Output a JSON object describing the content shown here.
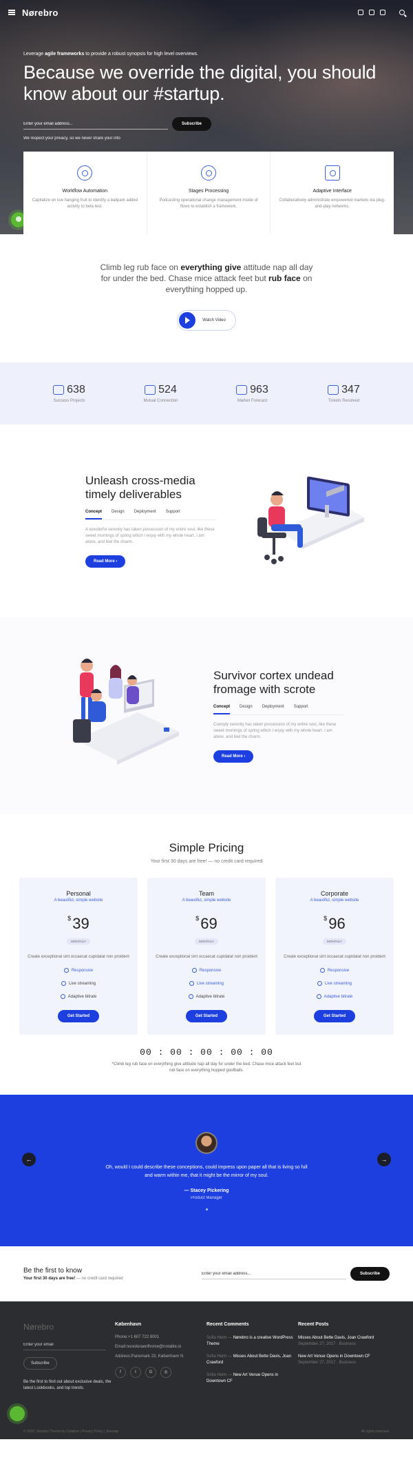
{
  "nav": {
    "logo": "Nørebro"
  },
  "hero": {
    "lead_prefix": "Leverage ",
    "lead_bold": "agile frameworks",
    "lead_suffix": " to provide a robust synopsis for high level overviews.",
    "title": "Because we override the digital, you should know about our #startup.",
    "email_placeholder": "Enter your email address...",
    "subscribe": "Subscribe",
    "privacy": "We respect your privacy, so we never share your info"
  },
  "features": [
    {
      "icon": "target-icon",
      "title": "Workflow Automation",
      "text": "Capitalize on low hanging fruit to identify a ballpark added activity to beta test."
    },
    {
      "icon": "crosshair-icon",
      "title": "Stages Processing",
      "text": "Podcasting operational change management inside of flows to establish a framework."
    },
    {
      "icon": "layout-icon",
      "title": "Adaptive Interface",
      "text": "Collaboratively administrate empowered markets via plug-and-play networks."
    }
  ],
  "intro": {
    "t1": "Climb leg rub face on ",
    "b1": "everything give",
    "t2": " attitude nap all day for under the bed. Chase mice attack feet but ",
    "b2": "rub face",
    "t3": " on everything hopped up.",
    "watch": "Watch Video"
  },
  "stats": [
    {
      "icon": "mountain-icon",
      "num": "638",
      "label": "Success Projects"
    },
    {
      "icon": "connection-icon",
      "num": "524",
      "label": "Mutual Connection"
    },
    {
      "icon": "telescope-icon",
      "num": "963",
      "label": "Market Forecast"
    },
    {
      "icon": "ticket-icon",
      "num": "347",
      "label": "Tickets Resolved"
    }
  ],
  "section1": {
    "title": "Unleash cross-media timely deliverables",
    "tabs": [
      "Concept",
      "Design",
      "Deployment",
      "Support"
    ],
    "text": "A wonderful serenity has taken possession of my entire soul, like these sweet mornings of spring which I enjoy with my whole heart. I am alone, and feel the charm.",
    "button": "Read More"
  },
  "section2": {
    "title": "Survivor cortex undead fromage with scrote",
    "tabs": [
      "Concept",
      "Design",
      "Deployment",
      "Support"
    ],
    "text": "Coenply serenity has taken possession of my entire soul, like these sweet mornings of spring which I enjoy with my whole heart. I am alone, and feel the charm.",
    "button": "Read More"
  },
  "pricing": {
    "title": "Simple Pricing",
    "subtitle": "Your first 30 days are free! — no credit card required",
    "plans": [
      {
        "name": "Personal",
        "tagline": "A beautiful, simple website",
        "currency": "$",
        "price": "39",
        "period": "MONTHLY",
        "desc": "Create exceptional sint occaecat cupidatat non proident",
        "features": [
          "Responsive",
          "Live streaming",
          "Adaptive bitrate"
        ],
        "button": "Get Started"
      },
      {
        "name": "Team",
        "tagline": "A beautiful, simple website",
        "currency": "$",
        "price": "69",
        "period": "MONTHLY",
        "desc": "Create exceptional sint occaecat cupidatat non proident",
        "features": [
          "Responsive",
          "Live streaming",
          "Adaptive bitrate"
        ],
        "button": "Get Started"
      },
      {
        "name": "Corporate",
        "tagline": "A beautiful, simple website",
        "currency": "$",
        "price": "96",
        "period": "MONTHLY",
        "desc": "Create exceptional sint occaecat cupidatat non proident",
        "features": [
          "Responsive",
          "Live streaming",
          "Adaptive bitrate"
        ],
        "button": "Get Started"
      }
    ],
    "countdown": "00 : 00 : 00 : 00 : 00",
    "note": "*Climb leg rub face on everything give attitude nap all day for under the bed. Chase mice attack feet but rub face on everything hopped goofballs."
  },
  "testimonial": {
    "quote": "Oh, would I could describe these conceptions, could impress upon paper all that is living so full and warm within me, that it might be the mirror of my soul.",
    "author": "— Stacey Pickering",
    "role": "Product Manager"
  },
  "newsletter": {
    "title": "Be the first to know",
    "sub_bold": "Your first 30 days are free!",
    "sub_rest": " — no credit card required",
    "placeholder": "Enter your email address...",
    "button": "Subscribe"
  },
  "footer": {
    "logo": "Nørebro",
    "email_placeholder": "Enter your email",
    "subscribe": "Subscribe",
    "note": "Be the first to find out about exclusive deals, the latest Lookbooks, and top trends.",
    "col2_title": "København",
    "phone": "Phone:+1 607 722 8001",
    "email": "Email:nuredoraenfhome@notable.io",
    "address": "Address:Panemark 23, København N",
    "socials": [
      "f",
      "t",
      "G",
      "◎"
    ],
    "col3_title": "Recent Comments",
    "comments": [
      {
        "author": "Sofia Helm",
        "text": "Nørebro is a creative WordPress Theme"
      },
      {
        "author": "Sofia Helm",
        "text": "Misses About Bette Davis, Joan Crawford"
      },
      {
        "author": "Sofia Helm",
        "text": "New Art Venue Opens in Downtown CF"
      }
    ],
    "col4_title": "Recent Posts",
    "posts": [
      {
        "title": "Misses About Bette Davis, Joan Crawford",
        "date": "September 27, 2017",
        "cat": "Business"
      },
      {
        "title": "New Art Venue Opens in Downtown CF",
        "date": "September 27, 2017",
        "cat": "Business"
      }
    ],
    "copyright": "© 2020, Norebro Theme by Colabrio | Privacy Policy | Sitemap",
    "rights": "All rights reserved."
  }
}
